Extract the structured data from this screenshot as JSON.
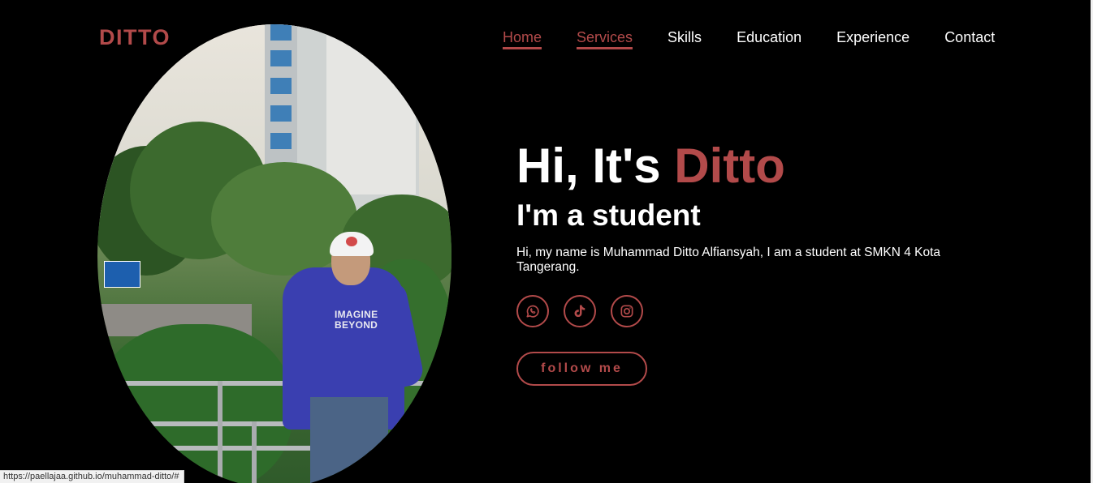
{
  "brand": {
    "logo": "DITTO",
    "accent_color": "#b24a4a"
  },
  "nav": {
    "items": [
      {
        "label": "Home",
        "active": true
      },
      {
        "label": "Services",
        "active": true
      },
      {
        "label": "Skills",
        "active": false
      },
      {
        "label": "Education",
        "active": false
      },
      {
        "label": "Experience",
        "active": false
      },
      {
        "label": "Contact",
        "active": false
      }
    ]
  },
  "hero": {
    "greeting_prefix": "Hi, It's ",
    "greeting_name": "Ditto",
    "role": "I'm a student",
    "bio": "Hi, my name is Muhammad Ditto Alfiansyah, I am a student at SMKN 4 Kota Tangerang.",
    "photo_shirt_text": "IMAGINE\nBEYOND"
  },
  "socials": [
    {
      "name": "whatsapp",
      "icon": "whatsapp-icon"
    },
    {
      "name": "tiktok",
      "icon": "tiktok-icon"
    },
    {
      "name": "instagram",
      "icon": "instagram-icon"
    }
  ],
  "cta": {
    "follow_label": "follow me"
  },
  "status_bar": {
    "url": "https://paellajaa.github.io/muhammad-ditto/#"
  }
}
